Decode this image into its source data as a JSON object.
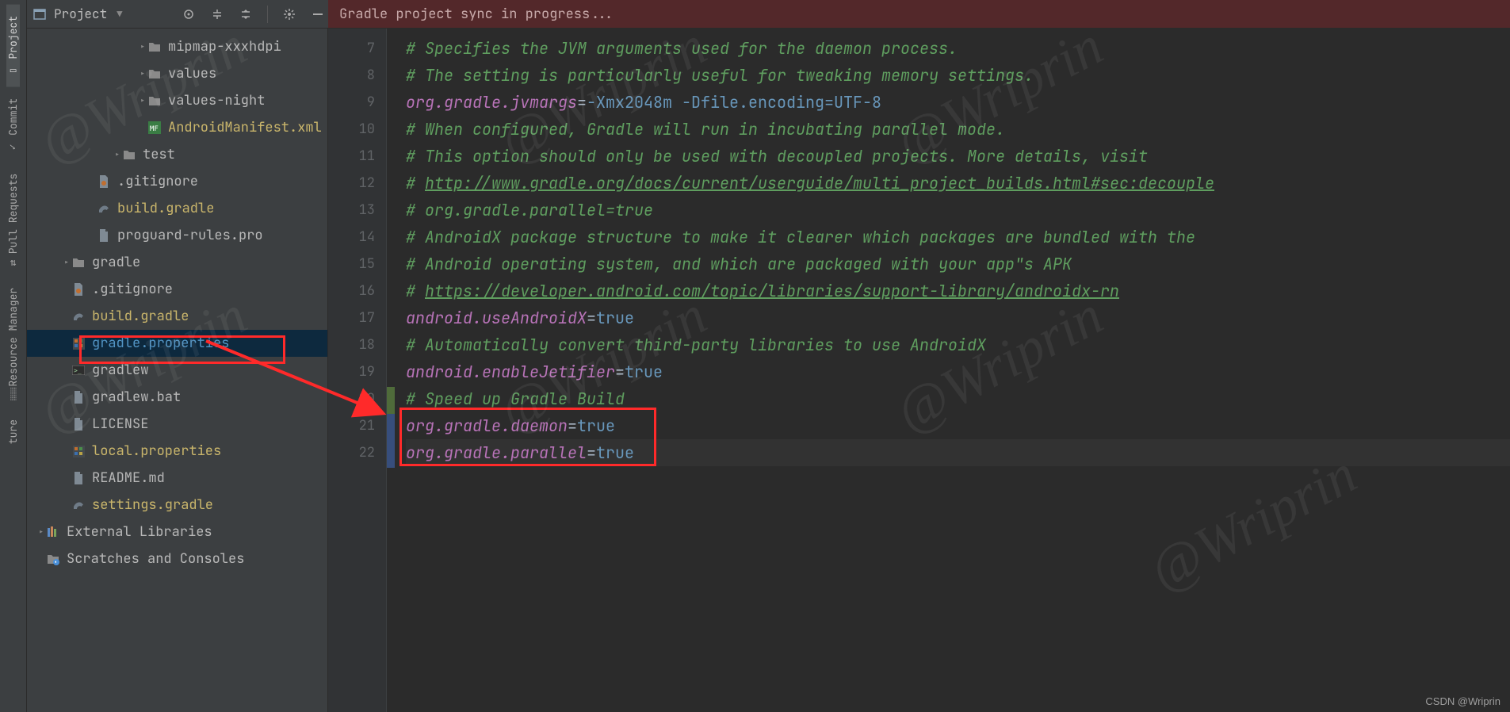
{
  "watermark_text": "@Wriprin",
  "csdn_credit": "CSDN @Wriprin",
  "sync_message": "Gradle project sync in progress...",
  "header": {
    "project_label": "Project",
    "buttons": {
      "target": "Select Opened File",
      "expand": "Expand All",
      "collapse": "Collapse All",
      "gear": "Settings",
      "hide": "Hide"
    }
  },
  "tool_strip": {
    "project": "Project",
    "commit": "Commit",
    "pull_requests": "Pull Requests",
    "resource_manager": "Resource Manager",
    "structure": "ture"
  },
  "tree": [
    {
      "depth": 4,
      "icon": "folder",
      "label": "mipmap-xxxhdpi",
      "arrow": ">"
    },
    {
      "depth": 4,
      "icon": "folder",
      "label": "values",
      "arrow": ">"
    },
    {
      "depth": 4,
      "icon": "folder",
      "label": "values-night",
      "arrow": ">"
    },
    {
      "depth": 4,
      "icon": "manifest",
      "label": "AndroidManifest.xml",
      "hl": "y"
    },
    {
      "depth": 3,
      "icon": "folder",
      "label": "test",
      "arrow": ">"
    },
    {
      "depth": 2,
      "icon": "gitignore",
      "label": ".gitignore"
    },
    {
      "depth": 2,
      "icon": "gradle",
      "label": "build.gradle",
      "hl": "y"
    },
    {
      "depth": 2,
      "icon": "file",
      "label": "proguard-rules.pro"
    },
    {
      "depth": 1,
      "icon": "folder",
      "label": "gradle",
      "arrow": ">"
    },
    {
      "depth": 1,
      "icon": "gitignore",
      "label": ".gitignore"
    },
    {
      "depth": 1,
      "icon": "gradle",
      "label": "build.gradle",
      "hl": "y"
    },
    {
      "depth": 1,
      "icon": "props",
      "label": "gradle.properties",
      "hl": "b",
      "selected": true
    },
    {
      "depth": 1,
      "icon": "sh",
      "label": "gradlew"
    },
    {
      "depth": 1,
      "icon": "file",
      "label": "gradlew.bat"
    },
    {
      "depth": 1,
      "icon": "file",
      "label": "LICENSE"
    },
    {
      "depth": 1,
      "icon": "props",
      "label": "local.properties",
      "hl": "y"
    },
    {
      "depth": 1,
      "icon": "file",
      "label": "README.md"
    },
    {
      "depth": 1,
      "icon": "gradle",
      "label": "settings.gradle",
      "hl": "y"
    },
    {
      "depth": 0,
      "icon": "lib",
      "label": "External Libraries",
      "arrow": ">"
    },
    {
      "depth": 0,
      "icon": "scratch",
      "label": "Scratches and Consoles"
    }
  ],
  "editor": {
    "first_line_number": 7,
    "lines": [
      {
        "n": 7,
        "segs": [
          {
            "t": "# Specifies the JVM arguments used for the daemon process.",
            "c": "comment"
          }
        ]
      },
      {
        "n": 8,
        "segs": [
          {
            "t": "# The setting is particularly useful for tweaking memory settings.",
            "c": "comment"
          }
        ]
      },
      {
        "n": 9,
        "segs": [
          {
            "t": "org.gradle.jvmargs",
            "c": "key"
          },
          {
            "t": "=",
            "c": "eq"
          },
          {
            "t": "-Xmx2048m -Dfile.encoding=UTF-8",
            "c": "val"
          }
        ]
      },
      {
        "n": 10,
        "segs": [
          {
            "t": "# When configured, Gradle will run in incubating parallel mode.",
            "c": "comment"
          }
        ]
      },
      {
        "n": 11,
        "segs": [
          {
            "t": "# This option should only be used with decoupled projects. More details, visit",
            "c": "comment"
          }
        ]
      },
      {
        "n": 12,
        "segs": [
          {
            "t": "# ",
            "c": "comment"
          },
          {
            "t": "http://www.gradle.org/docs/current/userguide/multi_project_builds.html#sec:decouple",
            "c": "link"
          }
        ]
      },
      {
        "n": 13,
        "segs": [
          {
            "t": "# org.gradle.parallel=true",
            "c": "comment"
          }
        ]
      },
      {
        "n": 14,
        "segs": [
          {
            "t": "# AndroidX package structure to make it clearer which packages are bundled with the",
            "c": "comment"
          }
        ]
      },
      {
        "n": 15,
        "segs": [
          {
            "t": "# Android operating system, and which are packaged with your app\"s APK",
            "c": "comment"
          }
        ]
      },
      {
        "n": 16,
        "segs": [
          {
            "t": "# ",
            "c": "comment"
          },
          {
            "t": "https://developer.android.com/topic/libraries/support-library/androidx-rn",
            "c": "link"
          }
        ]
      },
      {
        "n": 17,
        "segs": [
          {
            "t": "android.useAndroidX",
            "c": "key"
          },
          {
            "t": "=",
            "c": "eq"
          },
          {
            "t": "true",
            "c": "val"
          }
        ]
      },
      {
        "n": 18,
        "segs": [
          {
            "t": "# Automatically convert third-party libraries to use AndroidX",
            "c": "comment"
          }
        ]
      },
      {
        "n": 19,
        "segs": [
          {
            "t": "android.enableJetifier",
            "c": "key"
          },
          {
            "t": "=",
            "c": "eq"
          },
          {
            "t": "true",
            "c": "val"
          }
        ]
      },
      {
        "n": 20,
        "segs": [
          {
            "t": "# Speed up Gradle Build",
            "c": "comment"
          }
        ]
      },
      {
        "n": 21,
        "segs": [
          {
            "t": "org.gradle.daemon",
            "c": "key"
          },
          {
            "t": "=",
            "c": "eq"
          },
          {
            "t": "true",
            "c": "val"
          }
        ]
      },
      {
        "n": 22,
        "sel": true,
        "segs": [
          {
            "t": "org.gradle.parallel",
            "c": "key"
          },
          {
            "t": "=",
            "c": "eq"
          },
          {
            "t": "true",
            "c": "val"
          }
        ]
      }
    ]
  }
}
